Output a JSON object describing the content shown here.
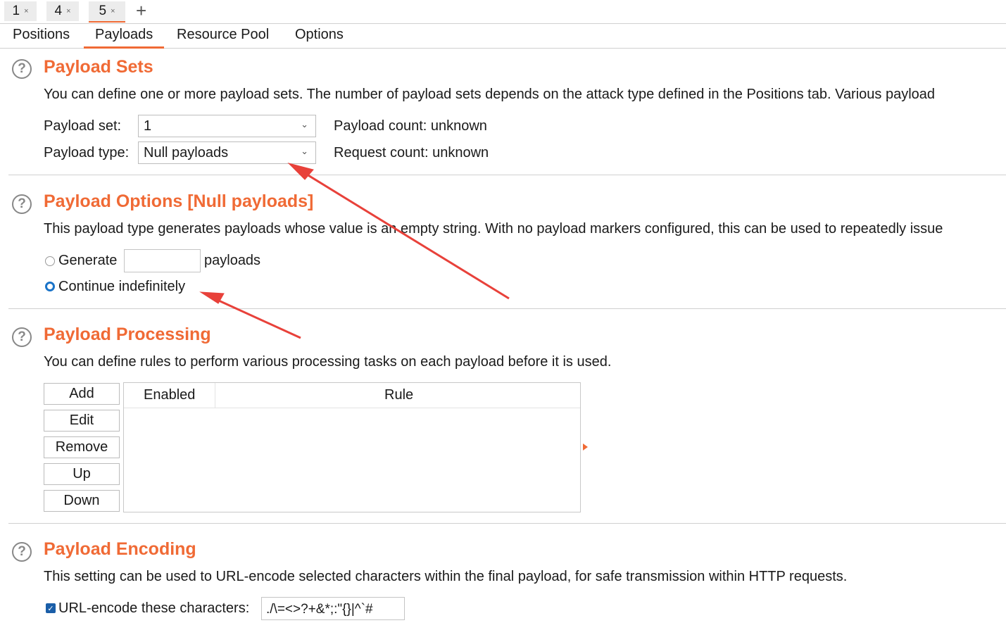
{
  "attack_tabs": [
    {
      "label": "1",
      "close": "×"
    },
    {
      "label": "4",
      "close": "×"
    },
    {
      "label": "5",
      "close": "×"
    }
  ],
  "new_tab_glyph": "+",
  "sub_tabs": [
    "Positions",
    "Payloads",
    "Resource Pool",
    "Options"
  ],
  "active_sub_tab": "Payloads",
  "accent_color": "#f06a35",
  "help_glyph": "?",
  "payload_sets": {
    "title": "Payload Sets",
    "description": "You can define one or more payload sets. The number of payload sets depends on the attack type defined in the Positions tab. Various payload",
    "set_label": "Payload set:",
    "set_value": "1",
    "type_label": "Payload type:",
    "type_value": "Null payloads",
    "payload_count": "Payload count: unknown",
    "request_count": "Request count: unknown"
  },
  "payload_options": {
    "title": "Payload Options [Null payloads]",
    "description": "This payload type generates payloads whose value is an empty string. With no payload markers configured, this can be used to repeatedly issue",
    "generate_label": "Generate",
    "generate_value": "",
    "payloads_suffix": "payloads",
    "continue_label": "Continue indefinitely",
    "selected": "continue"
  },
  "payload_processing": {
    "title": "Payload Processing",
    "description": "You can define rules to perform various processing tasks on each payload before it is used.",
    "buttons": [
      "Add",
      "Edit",
      "Remove",
      "Up",
      "Down"
    ],
    "columns": [
      "Enabled",
      "Rule"
    ],
    "rows": []
  },
  "payload_encoding": {
    "title": "Payload Encoding",
    "description": "This setting can be used to URL-encode selected characters within the final payload, for safe transmission within HTTP requests.",
    "checkbox_label": "URL-encode these characters:",
    "checked": true,
    "characters": "./\\=<>?+&*;:\"{}|^`#"
  },
  "annotation_color": "#e8413a"
}
